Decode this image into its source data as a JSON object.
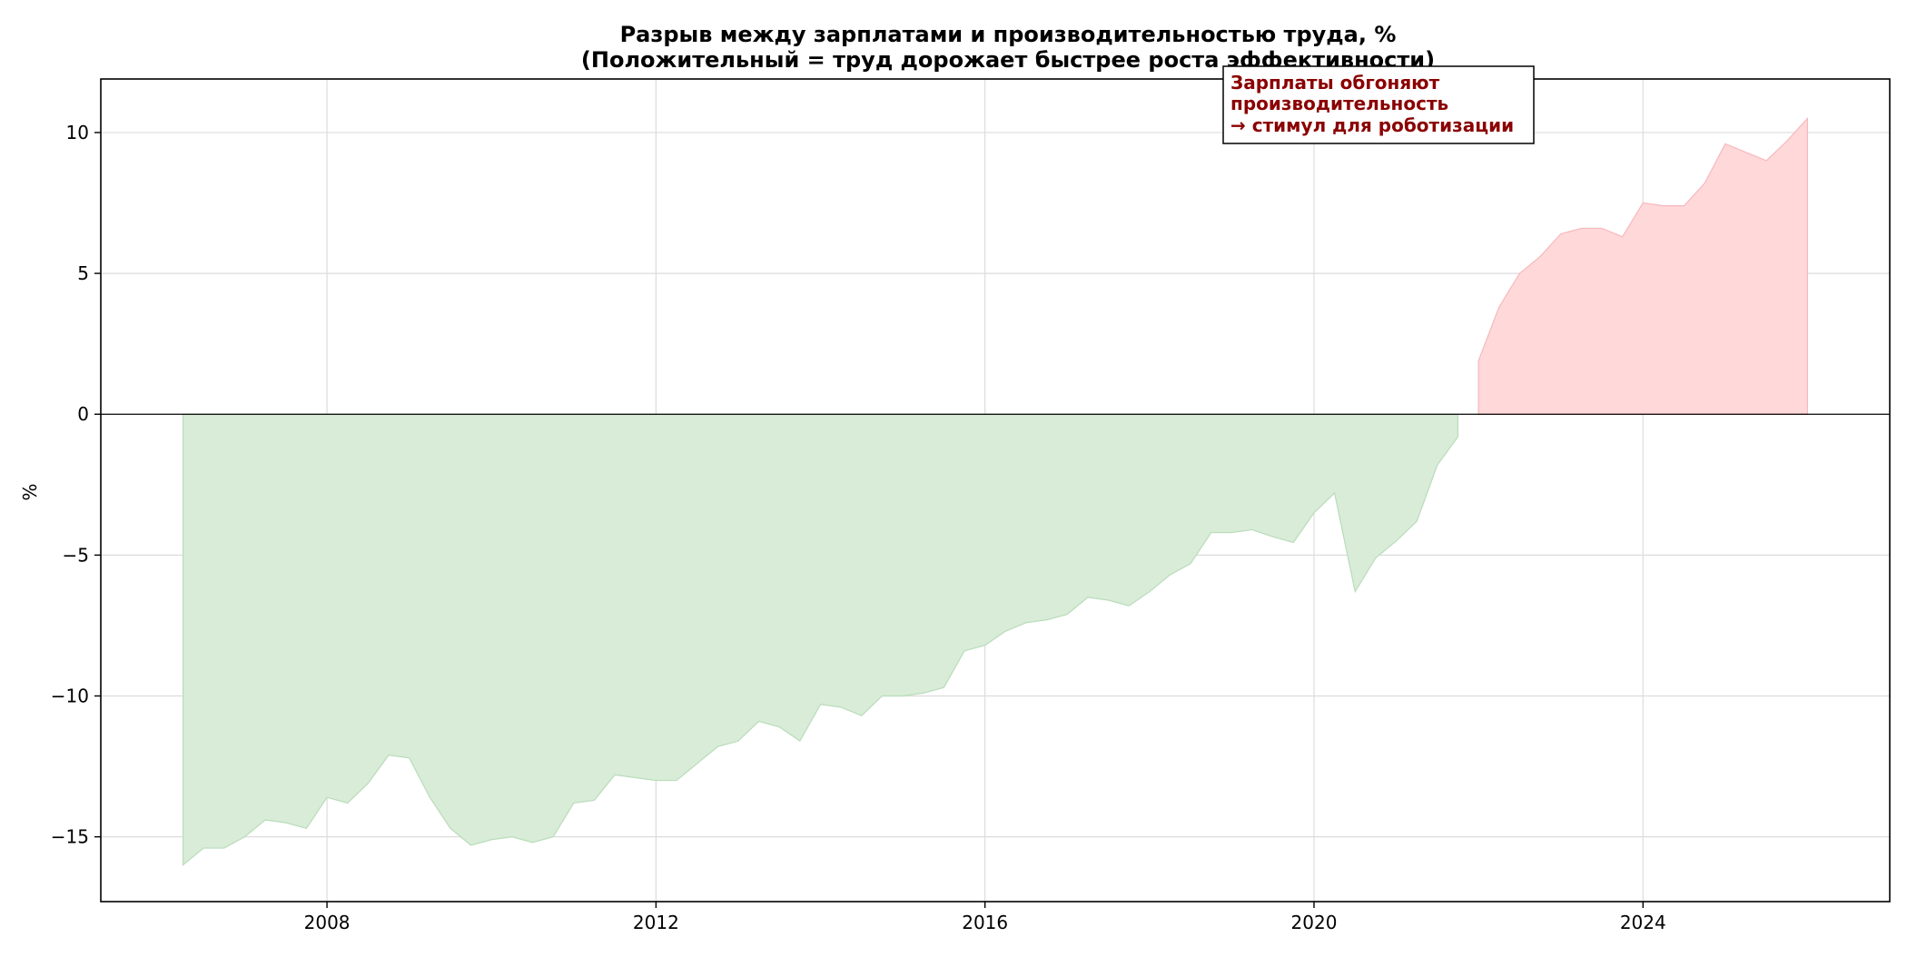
{
  "chart_data": {
    "type": "area",
    "title": "Разрыв между зарплатами и производительностью труда, %",
    "subtitle": "(Положительный = труд дорожает быстрее роста эффективности)",
    "xlabel": "",
    "ylabel": "%",
    "xlim": [
      2005.25,
      2027.0
    ],
    "ylim": [
      -17.3,
      11.9
    ],
    "x_ticks": [
      2008,
      2012,
      2016,
      2020,
      2024
    ],
    "y_ticks": [
      10,
      5,
      0,
      -5,
      -10,
      -15
    ],
    "y_tick_labels": [
      "10",
      "5",
      "0",
      "−5",
      "−10",
      "−15"
    ],
    "grid": true,
    "zero_line": true,
    "colors": {
      "negative": "#d8ecd8",
      "positive": "#ffd8da",
      "annotation": "#8b0000"
    },
    "annotation": {
      "lines": [
        "Зарплаты обгоняют",
        "производительность",
        "→ стимул для роботизации"
      ],
      "x": 2019.0,
      "y": 11.4
    },
    "series": [
      {
        "x": [
          2006.25,
          2006.5,
          2006.75,
          2007.0,
          2007.25,
          2007.5,
          2007.75,
          2008.0,
          2008.25,
          2008.5,
          2008.75,
          2009.0,
          2009.25,
          2009.5,
          2009.75,
          2010.0,
          2010.25,
          2010.5,
          2010.75,
          2011.0,
          2011.25,
          2011.5,
          2011.75,
          2012.0,
          2012.25,
          2012.5,
          2012.75,
          2013.0,
          2013.25,
          2013.5,
          2013.75,
          2014.0,
          2014.25,
          2014.5,
          2014.75,
          2015.0,
          2015.25,
          2015.5,
          2015.75,
          2016.0,
          2016.25,
          2016.5,
          2016.75,
          2017.0,
          2017.25,
          2017.5,
          2017.75,
          2018.0,
          2018.25,
          2018.5,
          2018.75,
          2019.0,
          2019.25,
          2019.5,
          2019.75,
          2020.0,
          2020.25,
          2020.5,
          2020.75,
          2021.0,
          2021.25,
          2021.5,
          2021.75
        ],
        "values": [
          -16.0,
          -15.4,
          -15.4,
          -15.0,
          -14.4,
          -14.5,
          -14.7,
          -13.6,
          -13.8,
          -13.1,
          -12.1,
          -12.2,
          -13.6,
          -14.7,
          -15.3,
          -15.1,
          -15.0,
          -15.2,
          -15.0,
          -13.8,
          -13.7,
          -12.8,
          -12.9,
          -13.0,
          -13.0,
          -12.4,
          -11.8,
          -11.6,
          -10.9,
          -11.1,
          -11.6,
          -10.3,
          -10.4,
          -10.7,
          -10.0,
          -10.0,
          -9.9,
          -9.7,
          -8.4,
          -8.2,
          -7.7,
          -7.4,
          -7.3,
          -7.1,
          -6.5,
          -6.6,
          -6.8,
          -6.3,
          -5.7,
          -5.3,
          -4.2,
          -4.2,
          -4.1,
          -4.35,
          -4.55,
          -3.5,
          -2.8,
          -6.3,
          -5.1,
          -4.5,
          -3.8,
          -1.8,
          -0.8
        ]
      },
      {
        "x": [
          2022.0,
          2022.25,
          2022.5,
          2022.75,
          2023.0,
          2023.25,
          2023.5,
          2023.75,
          2024.0,
          2024.25,
          2024.5,
          2024.75,
          2025.0,
          2025.25,
          2025.5,
          2025.75,
          2026.0
        ],
        "values": [
          1.9,
          3.8,
          5.0,
          5.6,
          6.4,
          6.6,
          6.6,
          6.3,
          7.5,
          7.4,
          7.4,
          8.2,
          9.6,
          9.3,
          9.0,
          9.7,
          10.5
        ]
      }
    ]
  }
}
